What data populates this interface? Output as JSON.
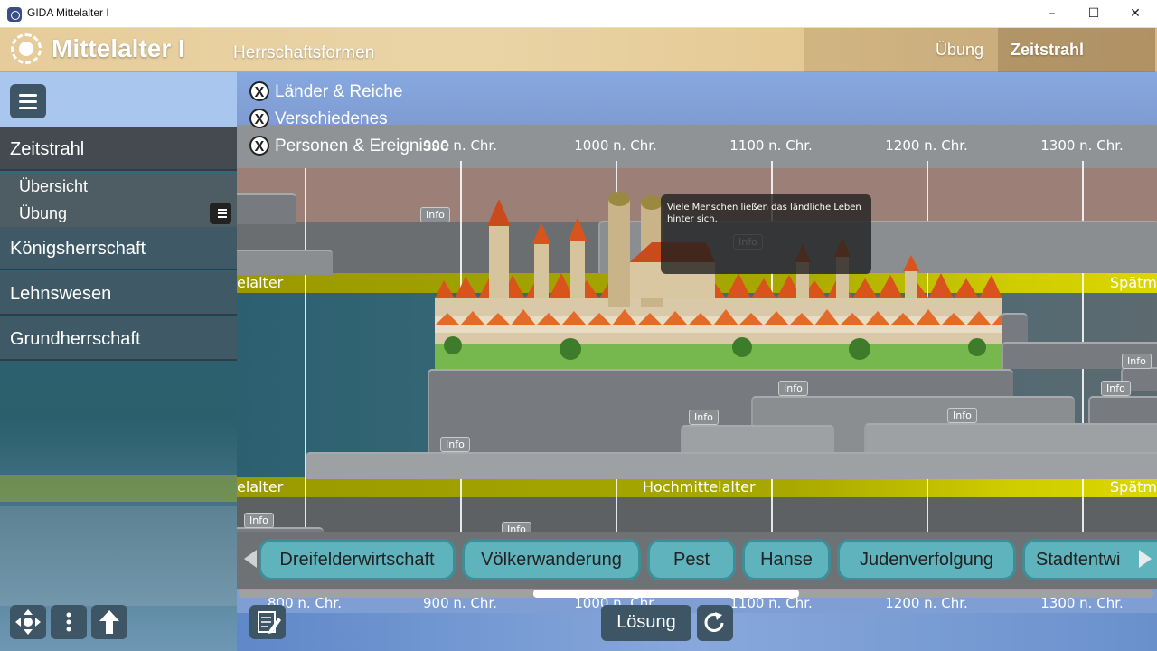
{
  "window": {
    "title": "GIDA Mittelalter I",
    "controls": {
      "minimize": "–",
      "maximize": "☐",
      "close": "✕"
    }
  },
  "header": {
    "app_title": "Mittelalter I",
    "section_title": "Herrschaftsformen",
    "tabs": {
      "uebung": "Übung",
      "zeitstrahl": "Zeitstrahl"
    }
  },
  "sidebar": {
    "zeitstrahl": "Zeitstrahl",
    "uebersicht": "Übersicht",
    "uebung": "Übung",
    "koenigsherrschaft": "Königsherrschaft",
    "lehnswesen": "Lehnswesen",
    "grundherrschaft": "Grundherrschaft"
  },
  "filters": {
    "laender": "Länder & Reiche",
    "verschiedenes": "Verschiedenes",
    "personen": "Personen & Ereignisse",
    "x": "X"
  },
  "timeline": {
    "top_ticks": [
      "900 n. Chr.",
      "1000 n. Chr.",
      "1100 n. Chr.",
      "1200 n. Chr.",
      "1300 n. Chr."
    ],
    "bottom_ticks": [
      "800 n. Chr.",
      "900 n. Chr.",
      "1000 n. Chr.",
      "1100 n. Chr.",
      "1200 n. Chr.",
      "1300 n. Chr."
    ],
    "epoch_upper": {
      "left": "elalter",
      "right": "Spätm"
    },
    "epoch_lower": {
      "left": "elalter",
      "center": "Hochmittelalter",
      "right": "Spätm"
    },
    "info_label": "Info",
    "tooltip": "Viele Menschen ließen das ländliche Leben hinter sich."
  },
  "chips": [
    "Dreifelderwirtschaft",
    "Völkerwanderung",
    "Pest",
    "Hanse",
    "Judenverfolgung",
    "Stadtentwi"
  ],
  "buttons": {
    "loesung": "Lösung"
  },
  "colors": {
    "accent": "#5fb3bd",
    "epoch": "#a8a800",
    "panel": "#3d5564"
  }
}
